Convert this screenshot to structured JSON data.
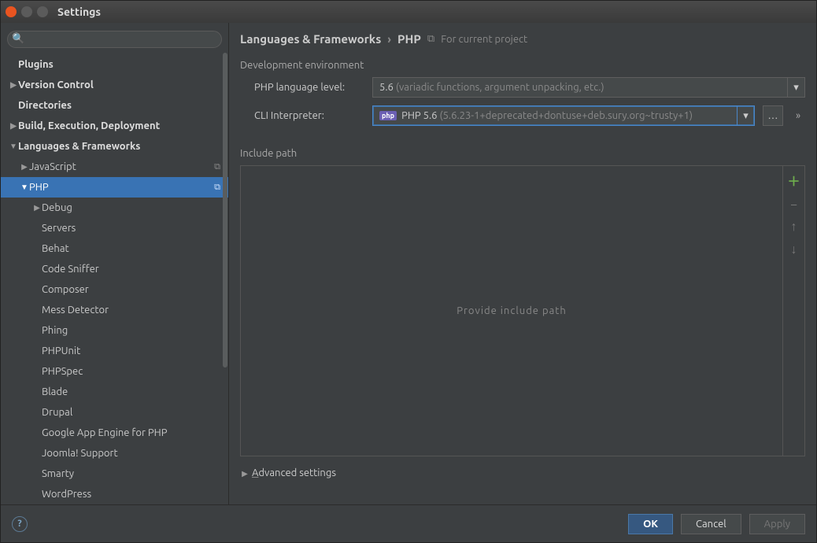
{
  "window": {
    "title": "Settings"
  },
  "search": {
    "placeholder": ""
  },
  "tree": {
    "plugins": "Plugins",
    "version_control": "Version Control",
    "directories": "Directories",
    "build": "Build, Execution, Deployment",
    "lang_fw": "Languages & Frameworks",
    "javascript": "JavaScript",
    "php": "PHP",
    "php_children": {
      "debug": "Debug",
      "servers": "Servers",
      "behat": "Behat",
      "code_sniffer": "Code Sniffer",
      "composer": "Composer",
      "mess_detector": "Mess Detector",
      "phing": "Phing",
      "phpunit": "PHPUnit",
      "phpspec": "PHPSpec",
      "blade": "Blade",
      "drupal": "Drupal",
      "gae": "Google App Engine for PHP",
      "joomla": "Joomla! Support",
      "smarty": "Smarty",
      "wordpress": "WordPress"
    }
  },
  "breadcrumb": {
    "root": "Languages & Frameworks",
    "leaf": "PHP",
    "scope": "For current project"
  },
  "dev_env": {
    "title": "Development environment",
    "lang_level_label": "PHP language level:",
    "lang_level_value": "5.6",
    "lang_level_hint": "(variadic functions, argument unpacking, etc.)",
    "cli_label": "CLI Interpreter:",
    "cli_icon_text": "php",
    "cli_value": "PHP 5.6",
    "cli_hint": "(5.6.23-1+deprecated+dontuse+deb.sury.org~trusty+1)",
    "more": "…"
  },
  "include": {
    "title": "Include path",
    "placeholder": "Provide include path"
  },
  "advanced": {
    "label": "Advanced settings",
    "underline": "A"
  },
  "footer": {
    "ok": "OK",
    "cancel": "Cancel",
    "apply": "Apply"
  }
}
